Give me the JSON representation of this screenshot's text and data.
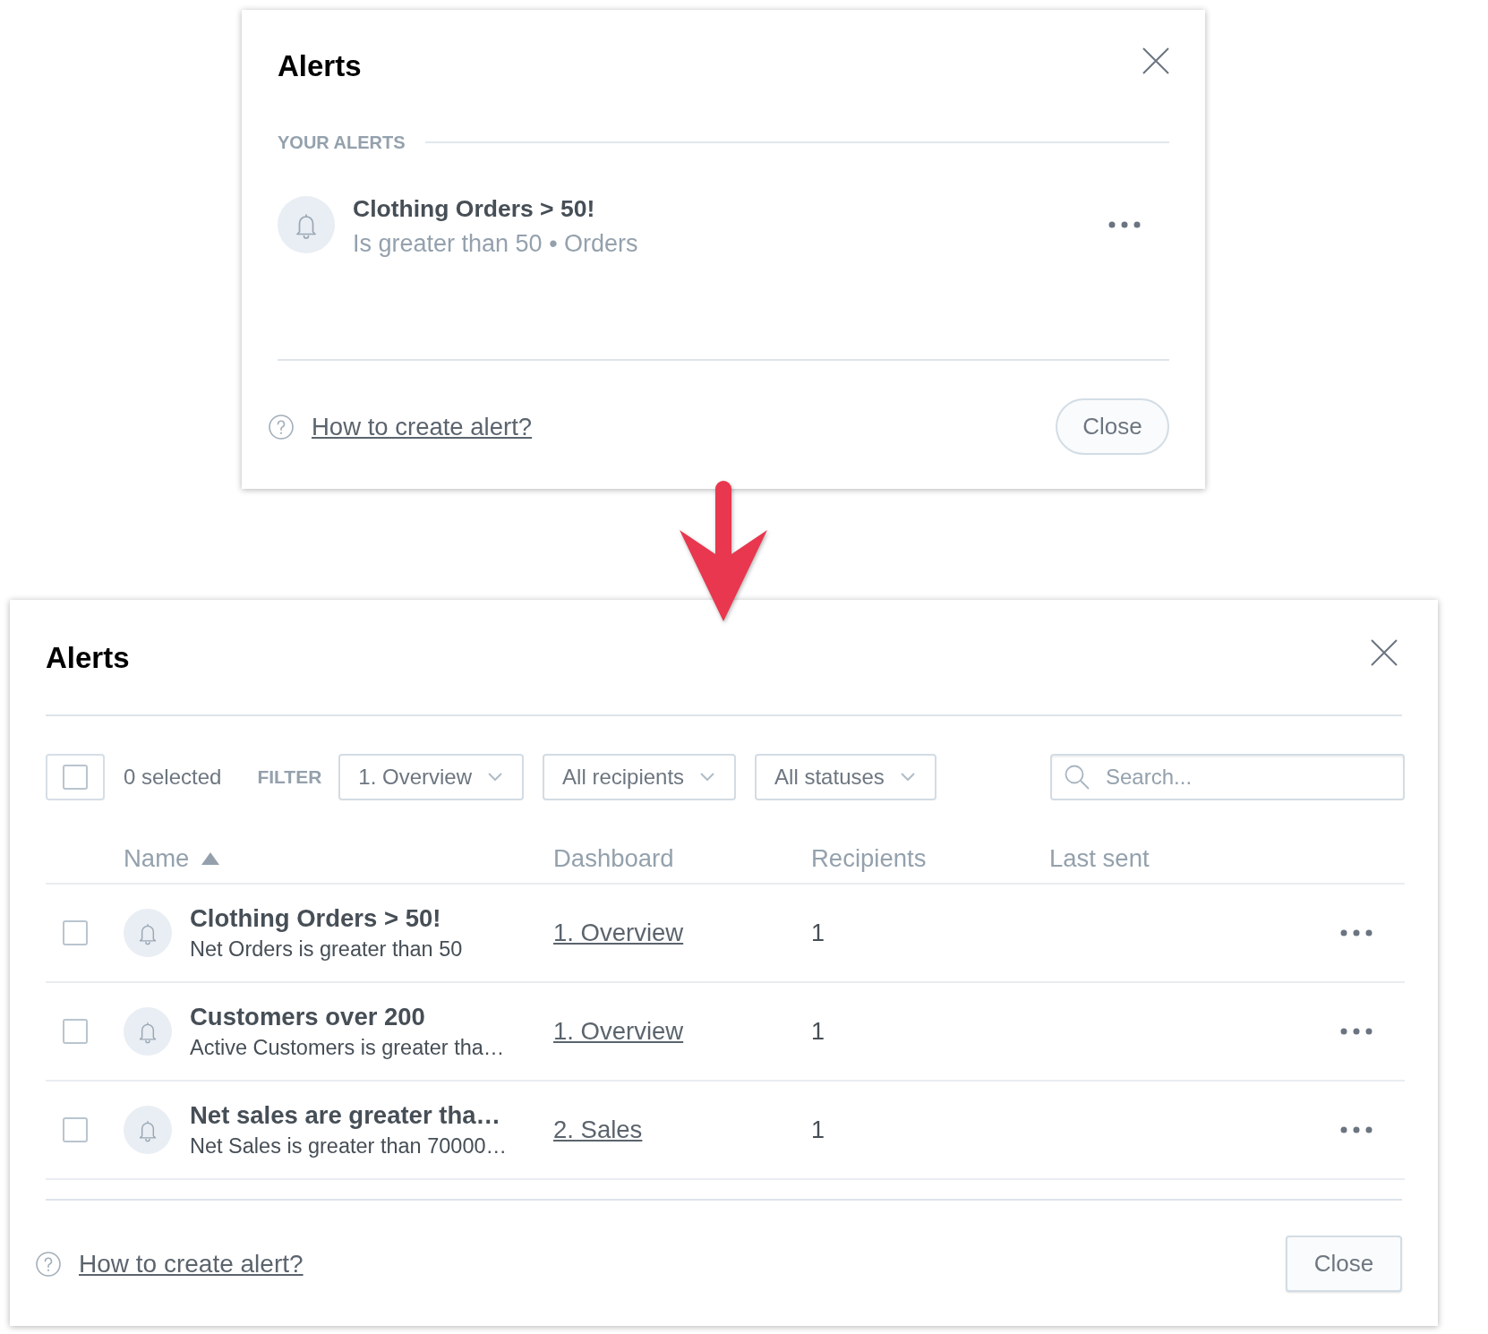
{
  "compact_dialog": {
    "title": "Alerts",
    "section_label": "YOUR ALERTS",
    "alerts": [
      {
        "name": "Clothing Orders > 50!",
        "details": "Is greater than 50 • Orders"
      }
    ],
    "help_link": "How to create alert?",
    "close_button": "Close"
  },
  "full_dialog": {
    "title": "Alerts",
    "toolbar": {
      "select_all": {
        "checked": false
      },
      "selected_count": "0 selected",
      "filter_label": "FILTER",
      "filters": [
        {
          "label": "1. Overview"
        },
        {
          "label": "All recipients"
        },
        {
          "label": "All statuses"
        }
      ],
      "search": {
        "placeholder": "Search..."
      }
    },
    "table": {
      "columns": [
        {
          "label": "Name",
          "sorted": true
        },
        {
          "label": "Dashboard",
          "sorted": false
        },
        {
          "label": "Recipients",
          "sorted": false
        },
        {
          "label": "Last sent",
          "sorted": false
        }
      ],
      "rows": [
        {
          "checked": false,
          "name": "Clothing Orders > 50!",
          "description": "Net Orders is greater than 50",
          "dashboard": "1. Overview",
          "recipients": "1"
        },
        {
          "checked": false,
          "name": "Customers over 200",
          "description": "Active Customers is greater tha…",
          "dashboard": "1. Overview",
          "recipients": "1"
        },
        {
          "checked": false,
          "name": "Net sales are greater tha…",
          "description": "Net Sales is greater than 70000…",
          "dashboard": "2. Sales",
          "recipients": "1"
        }
      ]
    },
    "help_link": "How to create alert?",
    "close_button": "Close"
  }
}
